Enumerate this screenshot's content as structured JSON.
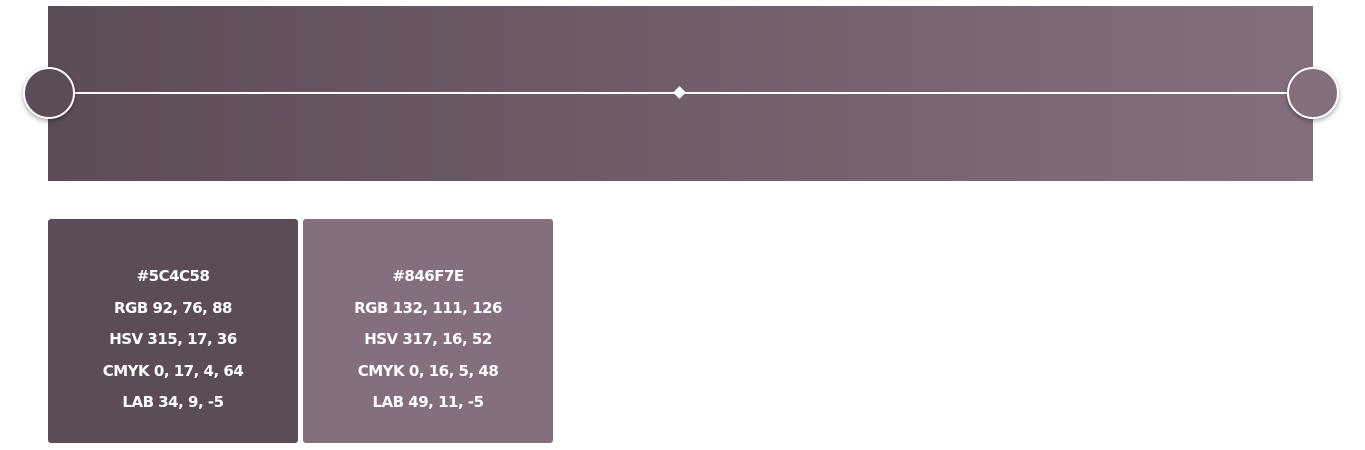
{
  "gradient": {
    "start_color": "#5C4C58",
    "end_color": "#846F7E"
  },
  "swatches": [
    {
      "color": "#5C4C58",
      "hex": "#5C4C58",
      "rgb": "RGB 92, 76, 88",
      "hsv": "HSV 315, 17, 36",
      "cmyk": "CMYK 0, 17, 4, 64",
      "lab": "LAB 34, 9, -5"
    },
    {
      "color": "#846F7E",
      "hex": "#846F7E",
      "rgb": "RGB 132, 111, 126",
      "hsv": "HSV 317, 16, 52",
      "cmyk": "CMYK 0, 16, 5, 48",
      "lab": "LAB 49, 11, -5"
    }
  ]
}
